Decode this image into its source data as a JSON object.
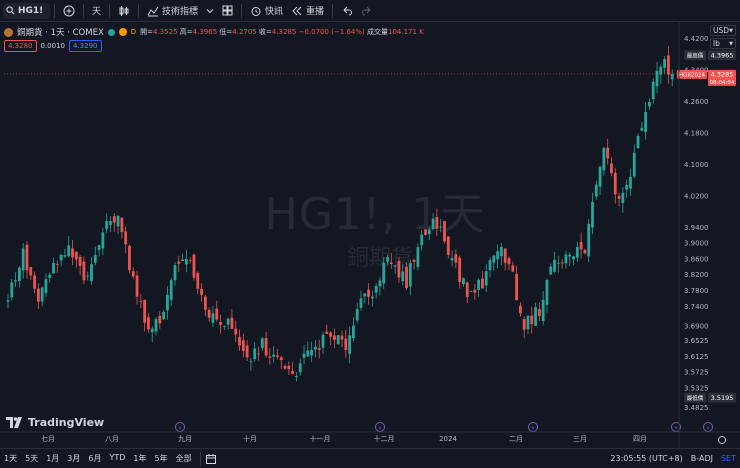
{
  "toolbar": {
    "symbol": "HG1!",
    "interval": "天",
    "indicators_label": "技術指標",
    "alert_label": "快訊",
    "replay_label": "重播"
  },
  "legend": {
    "title": "銅期貨 · 1天 · COMEX",
    "d_badge": "D",
    "open_label": "開=",
    "open": "4.3525",
    "high_label": "高=",
    "high": "4.3965",
    "low_label": "低=",
    "low": "4.2705",
    "close_label": "收=",
    "close": "4.3285",
    "change": "−0.0700 (−1.64%)",
    "volume_label": "成交量",
    "volume": "104.171 K",
    "bid": "4.3280",
    "spread": "0.0010",
    "ask": "4.3290"
  },
  "right_panel": {
    "currency": "USD",
    "unit": "lb"
  },
  "price_axis": {
    "labels": [
      "4.4200",
      "4.3400",
      "4.2600",
      "4.1800",
      "4.1000",
      "4.0200",
      "3.9400",
      "3.9000",
      "3.8600",
      "3.8200",
      "3.7800",
      "3.7400",
      "3.6900",
      "3.6525",
      "3.6125",
      "3.5725",
      "3.5325",
      "3.4825"
    ],
    "high_tag_label": "最高價",
    "high_tag_value": "4.3965",
    "symbol_tag": "HGK2024",
    "last_price": "4.3285",
    "countdown": "06:04:04",
    "low_tag_label": "最低價",
    "low_tag_value": "3.5195"
  },
  "time_axis": [
    "七月",
    "八月",
    "九月",
    "十月",
    "十一月",
    "十二月",
    "2024",
    "二月",
    "三月",
    "四月"
  ],
  "watermark": {
    "main": "HG1!, 1天",
    "sub": "銅期貨"
  },
  "brand": "TradingView",
  "bottombar": {
    "periods": [
      "1天",
      "5天",
      "1月",
      "3月",
      "6月",
      "YTD",
      "1年",
      "5年",
      "全部"
    ],
    "time": "23:05:55 (UTC+8)",
    "adj": "B-ADJ",
    "set": "SET"
  },
  "colors": {
    "up": "#26a69a",
    "down": "#ef5350",
    "bg": "#131722",
    "accent": "#2962ff"
  },
  "chart_data": {
    "type": "candlestick",
    "y_range": [
      3.45,
      4.44
    ],
    "anchors": [
      [
        0,
        3.76
      ],
      [
        4,
        3.87
      ],
      [
        8,
        3.75
      ],
      [
        12,
        3.84
      ],
      [
        16,
        3.88
      ],
      [
        21,
        3.8
      ],
      [
        25,
        3.93
      ],
      [
        29,
        3.98
      ],
      [
        33,
        3.8
      ],
      [
        36,
        3.7
      ],
      [
        40,
        3.69
      ],
      [
        43,
        3.82
      ],
      [
        47,
        3.87
      ],
      [
        50,
        3.78
      ],
      [
        53,
        3.72
      ],
      [
        58,
        3.69
      ],
      [
        63,
        3.6
      ],
      [
        67,
        3.64
      ],
      [
        71,
        3.6
      ],
      [
        75,
        3.56
      ],
      [
        79,
        3.62
      ],
      [
        84,
        3.66
      ],
      [
        89,
        3.64
      ],
      [
        93,
        3.76
      ],
      [
        96,
        3.78
      ],
      [
        100,
        3.85
      ],
      [
        105,
        3.8
      ],
      [
        108,
        3.9
      ],
      [
        112,
        3.95
      ],
      [
        114,
        3.94
      ],
      [
        117,
        3.86
      ],
      [
        121,
        3.77
      ],
      [
        125,
        3.8
      ],
      [
        129,
        3.89
      ],
      [
        132,
        3.85
      ],
      [
        136,
        3.69
      ],
      [
        140,
        3.73
      ],
      [
        143,
        3.84
      ],
      [
        147,
        3.86
      ],
      [
        152,
        3.89
      ],
      [
        155,
        4.04
      ],
      [
        157,
        4.14
      ],
      [
        161,
        4.0
      ],
      [
        164,
        4.08
      ],
      [
        167,
        4.2
      ],
      [
        169,
        4.26
      ],
      [
        172,
        4.36
      ],
      [
        175,
        4.33
      ]
    ],
    "last_close": 4.3285
  }
}
